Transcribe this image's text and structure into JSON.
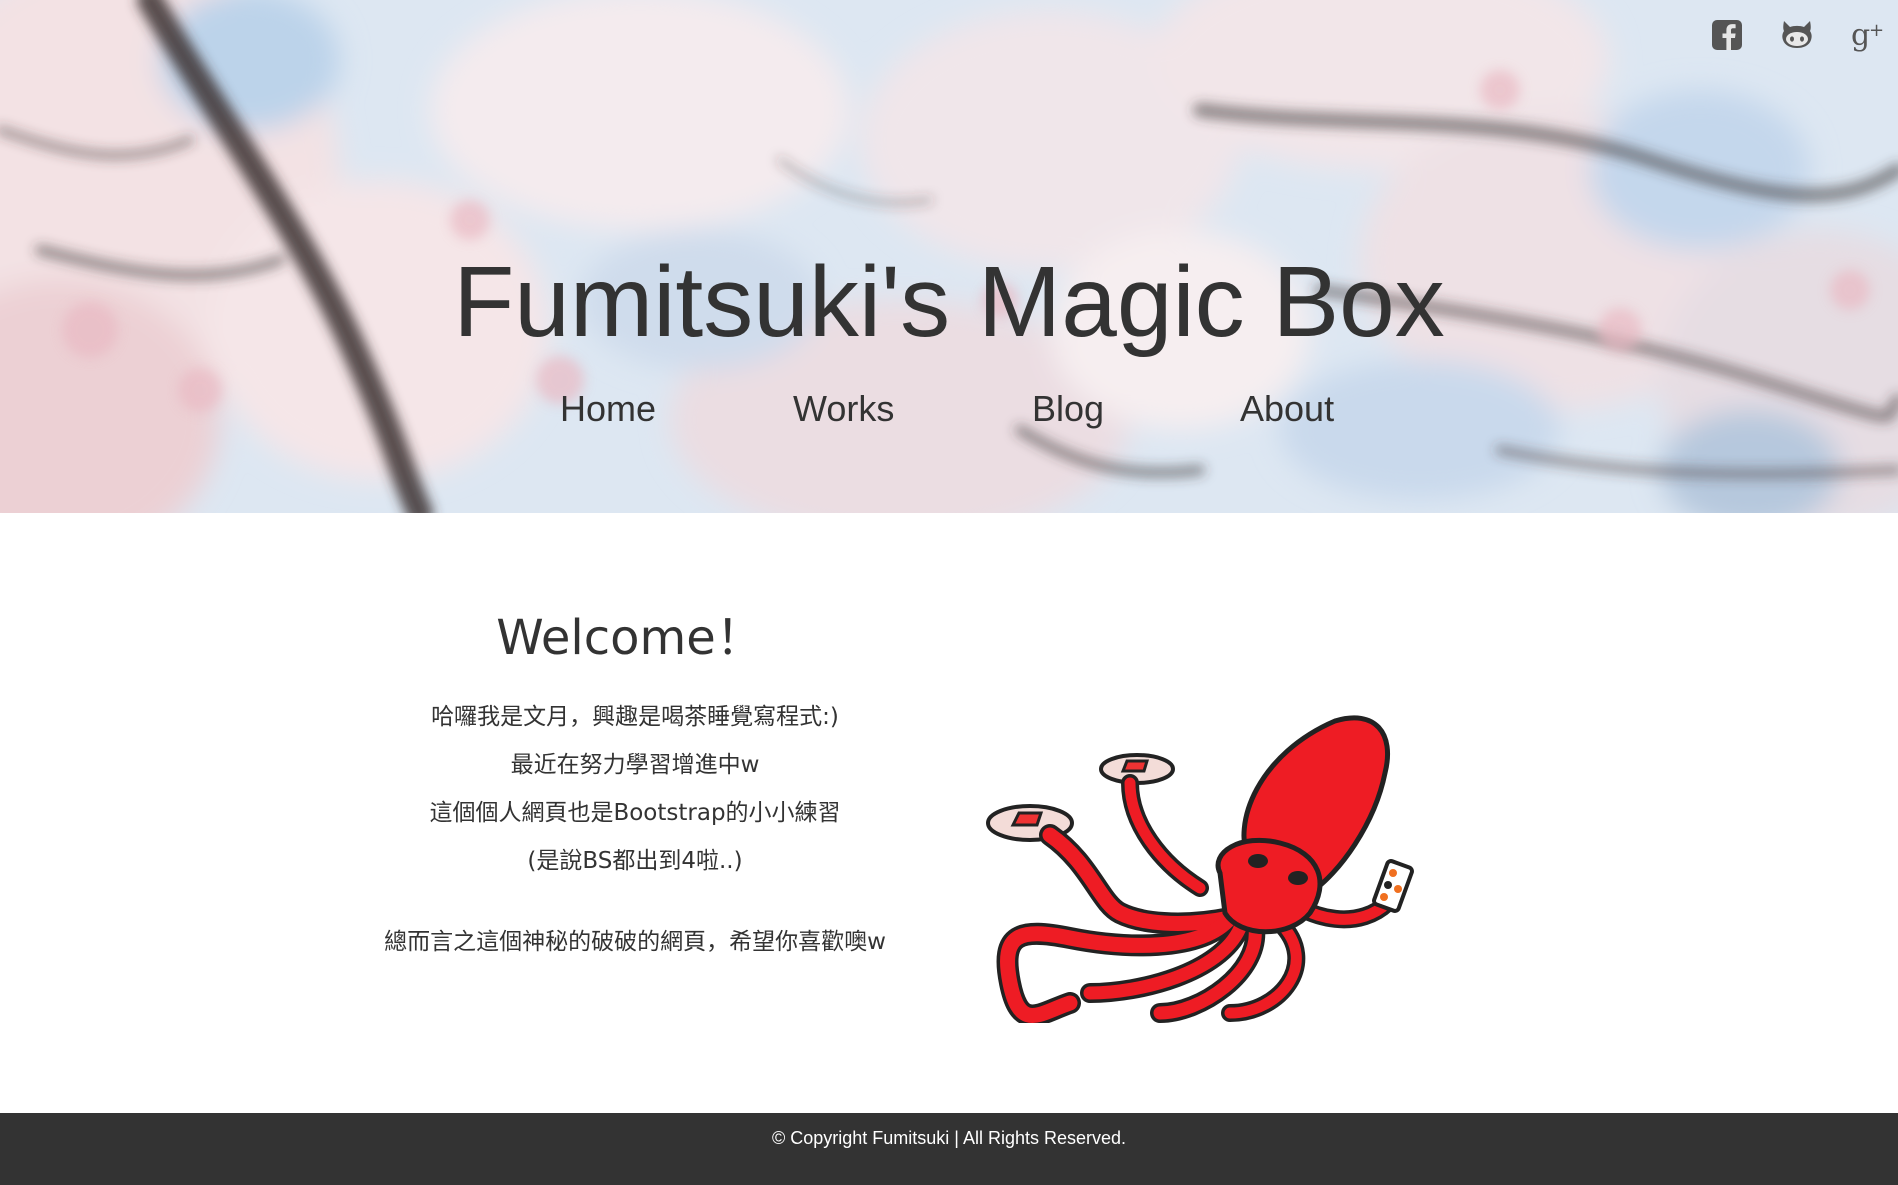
{
  "header": {
    "title": "Fumitsuki's Magic Box",
    "social": [
      {
        "icon": "facebook-icon"
      },
      {
        "icon": "github-icon"
      },
      {
        "icon": "google-plus-icon"
      }
    ],
    "nav": [
      "Home",
      "Works",
      "Blog",
      "About"
    ]
  },
  "main": {
    "welcome": "Welcome！",
    "lines": [
      "哈囉我是文月，興趣是喝茶睡覺寫程式:)",
      "最近在努力學習增進中w",
      "這個個人網頁也是Bootstrap的小小練習",
      "(是說BS都出到4啦..)"
    ],
    "closing": "總而言之這個神秘的破破的網頁，希望你喜歡噢w",
    "image": "red-squid-illustration"
  },
  "footer": {
    "text": "© Copyright Fumitsuki | All Rights Reserved."
  },
  "colors": {
    "text": "#333333",
    "footer_bg": "#333333",
    "footer_text": "#ffffff",
    "squid": "#ee1c24"
  }
}
